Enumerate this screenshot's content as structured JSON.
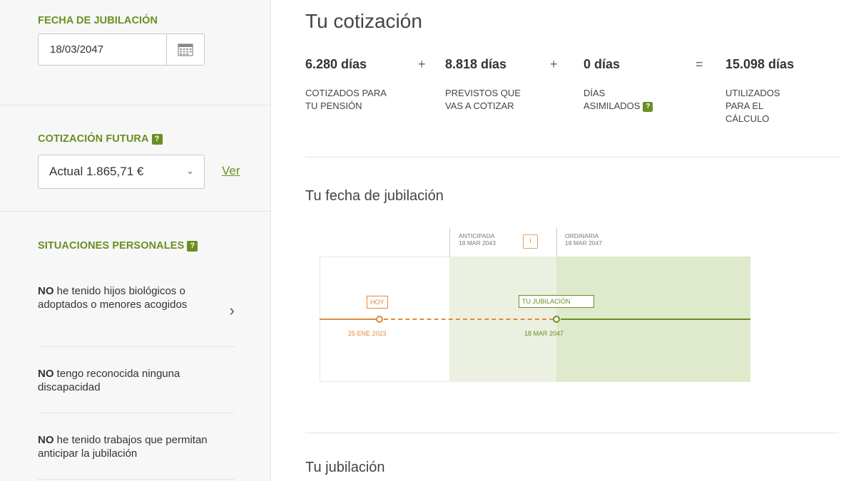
{
  "sidebar": {
    "fecha_jubilacion": {
      "title": "FECHA DE JUBILACIÓN",
      "value": "18/03/2047",
      "calendar_icon": "calendar-icon"
    },
    "cotizacion_futura": {
      "title": "COTIZACIÓN FUTURA",
      "help": "?",
      "select_value": "Actual 1.865,71 €",
      "link_label": "Ver"
    },
    "situaciones": {
      "title": "SITUACIONES PERSONALES",
      "help": "?",
      "items": [
        {
          "bold": "NO",
          "text": " he tenido hijos biológicos o adoptados o menores acogidos"
        },
        {
          "bold": "NO",
          "text": " tengo reconocida ninguna discapacidad"
        },
        {
          "bold": "NO",
          "text": " he tenido trabajos que permitan anticipar la jubilación"
        }
      ]
    }
  },
  "main": {
    "title": "Tu cotización",
    "stats": [
      {
        "value": "6.280 días",
        "label_line1": "COTIZADOS PARA",
        "label_line2": "TU PENSIÓN"
      },
      {
        "value": "8.818 días",
        "label_line1": "PREVISTOS QUE",
        "label_line2": "VAS A COTIZAR"
      },
      {
        "value": "0 días",
        "label_line1": "DÍAS",
        "label_line2": "ASIMILADOS",
        "help": "?"
      },
      {
        "value": "15.098 días",
        "label_line1": "UTILIZADOS",
        "label_line2": "PARA EL",
        "label_line3": "CÁLCULO"
      }
    ],
    "ops": [
      "+",
      "+",
      "="
    ],
    "fecha_title": "Tu fecha de jubilación",
    "timeline": {
      "anticipada_label": "ANTICIPADA",
      "anticipada_date": "18 MAR 2043",
      "ordinaria_label": "ORDINARIA",
      "ordinaria_date": "18 MAR 2047",
      "info_glyph": "i",
      "hoy_label": "HOY",
      "hoy_date": "25 ENE 2023",
      "jubilacion_label": "TU JUBILACIÓN",
      "jubilacion_date": "18 MAR 2047"
    },
    "jubilacion_title": "Tu jubilación"
  },
  "colors": {
    "accent_green": "#6b8e23",
    "accent_orange": "#e08a3c"
  }
}
